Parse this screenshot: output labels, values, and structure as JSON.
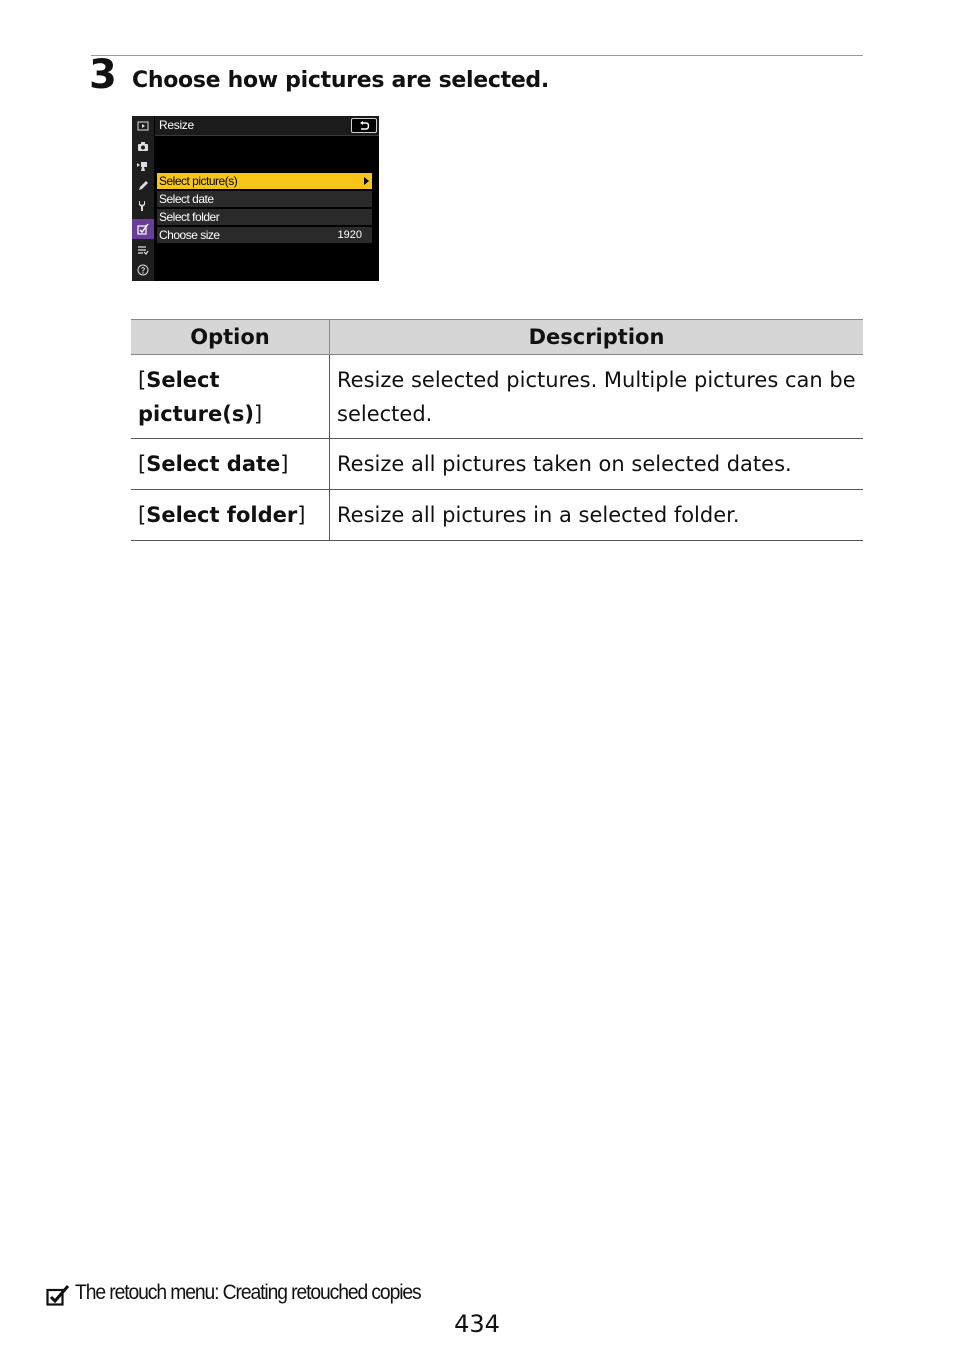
{
  "step": {
    "number": "3",
    "text": "Choose how pictures are selected."
  },
  "camera_screen": {
    "title": "Resize",
    "back_icon": "return-arrow-icon",
    "side_tabs": [
      {
        "icon": "playback-icon",
        "active": false
      },
      {
        "icon": "camera-icon",
        "active": false
      },
      {
        "icon": "movie-icon",
        "active": false
      },
      {
        "icon": "pencil-icon",
        "active": false
      },
      {
        "icon": "wrench-icon",
        "active": false
      },
      {
        "icon": "retouch-icon",
        "active": true
      },
      {
        "icon": "my-menu-icon",
        "active": false
      },
      {
        "icon": "help-icon",
        "active": false
      }
    ],
    "items": [
      {
        "label": "Select picture(s)",
        "value": "",
        "selected": true
      },
      {
        "label": "Select date",
        "value": "",
        "selected": false
      },
      {
        "label": "Select folder",
        "value": "",
        "selected": false
      },
      {
        "label": "Choose size",
        "value": "1920",
        "selected": false
      }
    ],
    "colors": {
      "highlight": "#f5c518",
      "active_tab": "#6a3d96"
    }
  },
  "table": {
    "headers": [
      "Option",
      "Description"
    ],
    "rows": [
      {
        "option": "Select picture(s)",
        "description": "Resize selected pictures. Multiple pictures can be selected."
      },
      {
        "option": "Select date",
        "description": "Resize all pictures taken on selected dates."
      },
      {
        "option": "Select folder",
        "description": "Resize all pictures in a selected folder."
      }
    ]
  },
  "footer": {
    "icon": "retouch-icon",
    "link_text": "The retouch menu: Creating retouched copies",
    "page_number": "434"
  }
}
